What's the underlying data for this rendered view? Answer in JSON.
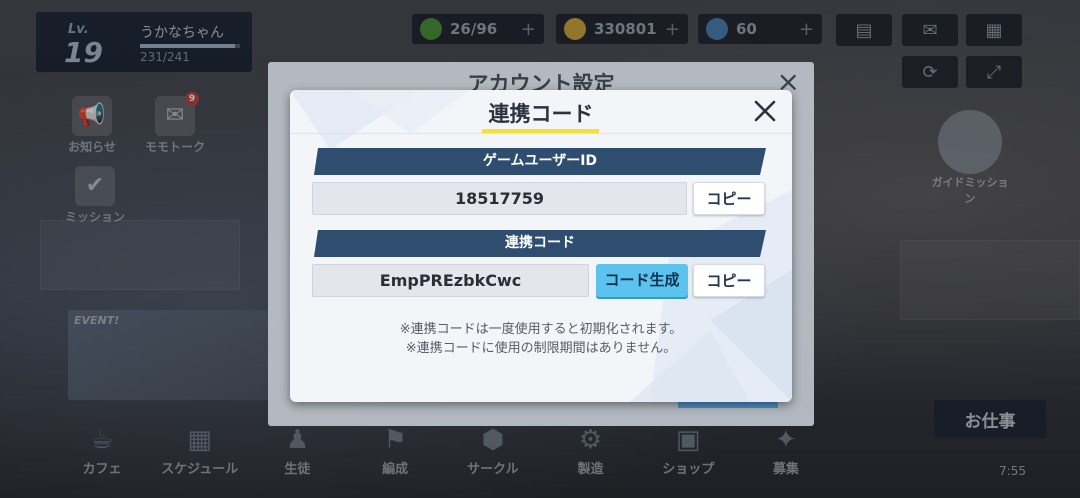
{
  "player": {
    "level_label": "Lv.",
    "level": "19",
    "name": "うかなちゃん",
    "exp": "231/241",
    "exp_fill": 0.95
  },
  "resources": [
    {
      "name": "stamina",
      "value": "26/96",
      "icon": "lightning-icon",
      "color": "#4a8f3c"
    },
    {
      "name": "coins",
      "value": "330801",
      "icon": "coin-icon",
      "color": "#c9a23a"
    },
    {
      "name": "gems",
      "value": "60",
      "icon": "gem-icon",
      "color": "#4a7fb0"
    }
  ],
  "side_menu": {
    "news": "お知らせ",
    "momotalk": "モモトーク",
    "momotalk_badge": "9",
    "mission": "ミッション"
  },
  "event_banner_label": "EVENT!",
  "guide_mission": "ガイドミッション",
  "work_button": "お仕事",
  "clock": "7:55",
  "bottom_nav": [
    {
      "label": "カフェ",
      "icon": "cafe-icon",
      "glyph": "☕"
    },
    {
      "label": "スケジュール",
      "icon": "schedule-icon",
      "glyph": "▦"
    },
    {
      "label": "生徒",
      "icon": "students-icon",
      "glyph": "♟"
    },
    {
      "label": "編成",
      "icon": "formation-icon",
      "glyph": "⚑"
    },
    {
      "label": "サークル",
      "icon": "circle-icon",
      "glyph": "⬢"
    },
    {
      "label": "製造",
      "icon": "craft-icon",
      "glyph": "⚙"
    },
    {
      "label": "ショップ",
      "icon": "shop-icon",
      "glyph": "▣"
    },
    {
      "label": "募集",
      "icon": "recruit-icon",
      "glyph": "✦"
    }
  ],
  "account_dialog": {
    "title": "アカウント設定",
    "close": "×"
  },
  "link_dialog": {
    "title": "連携コード",
    "user_id_header": "ゲームユーザーID",
    "user_id": "18517759",
    "copy_label": "コピー",
    "code_header": "連携コード",
    "code": "EmpPREzbkCwc",
    "generate_label": "コード生成",
    "note_1": "※連携コードは一度使用すると初期化されます。",
    "note_2": "※連携コードに使用の制限期間はありません。"
  },
  "colors": {
    "section_bar": "#2f4d6f",
    "generate_button": "#5cc2ee",
    "title_underline": "#f2e23a"
  }
}
